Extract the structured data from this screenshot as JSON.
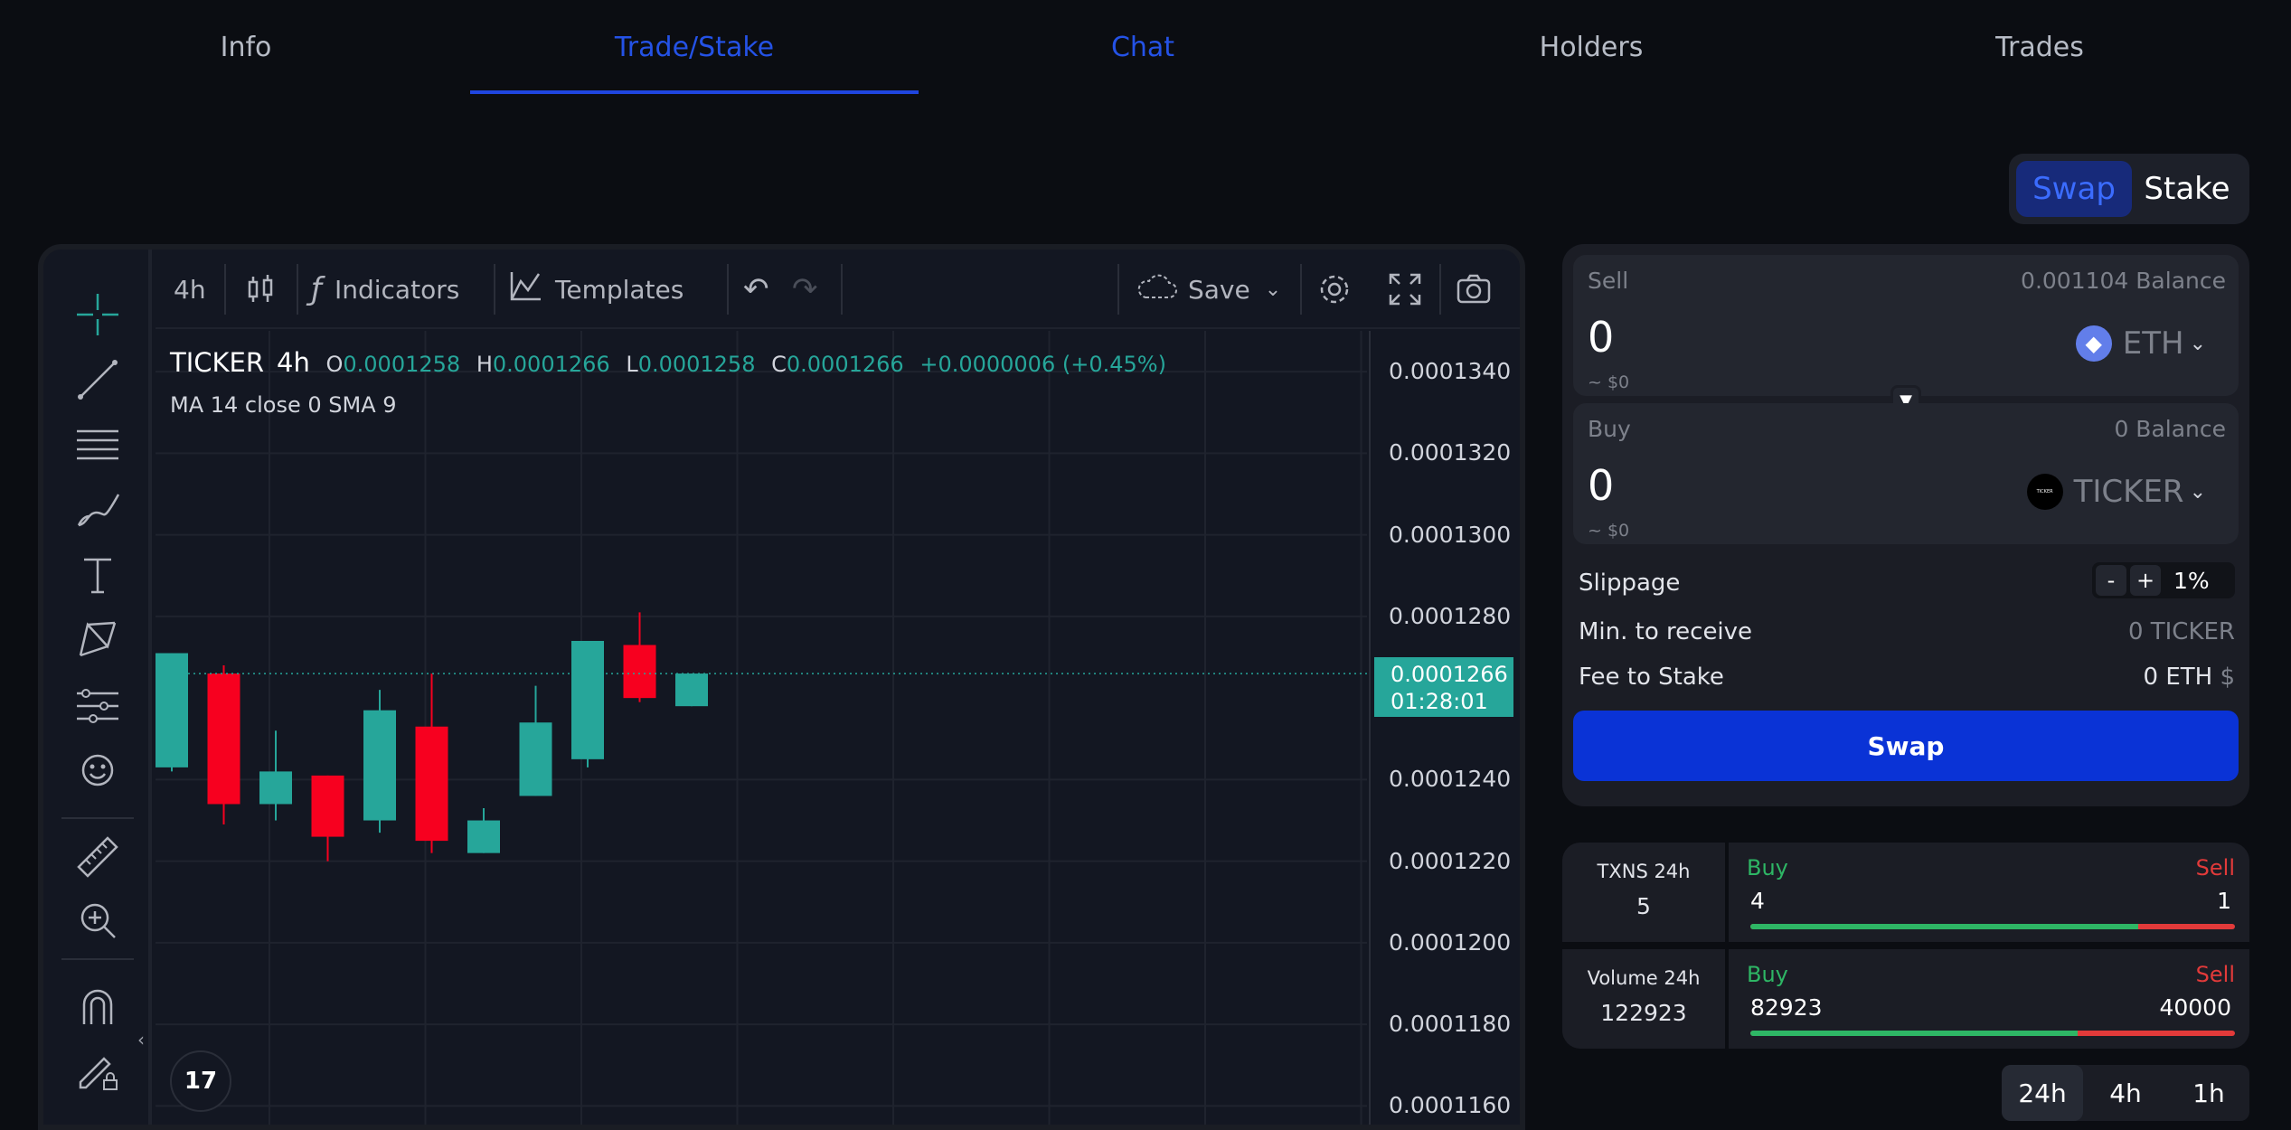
{
  "tabs": [
    "Info",
    "Trade/Stake",
    "Chat",
    "Holders",
    "Trades"
  ],
  "chart": {
    "toolbar": {
      "interval": "4h",
      "indicators": "Indicators",
      "templates": "Templates",
      "save": "Save"
    },
    "legend": {
      "symbol": "TICKER",
      "interval": "4h",
      "o_label": "O",
      "o": "0.0001258",
      "h_label": "H",
      "h": "0.0001266",
      "l_label": "L",
      "l": "0.0001258",
      "c_label": "C",
      "c": "0.0001266",
      "change": "+0.0000006 (+0.45%)",
      "ma": "MA 14 close 0 SMA 9"
    },
    "price_labels": [
      "0.0001340",
      "0.0001320",
      "0.0001300",
      "0.0001280",
      "0.0001240",
      "0.0001220",
      "0.0001200",
      "0.0001180",
      "0.0001160"
    ],
    "current_price": "0.0001266",
    "countdown": "01:28:01",
    "logo": "17"
  },
  "chart_data": {
    "type": "candlestick",
    "ylim": [
      0.0001155,
      0.000135
    ],
    "candles": [
      {
        "o": 0.0001243,
        "h": 0.0001262,
        "l": 0.0001242,
        "c": 0.0001271
      },
      {
        "o": 0.0001266,
        "h": 0.0001268,
        "l": 0.0001229,
        "c": 0.0001234
      },
      {
        "o": 0.0001234,
        "h": 0.0001252,
        "l": 0.000123,
        "c": 0.0001242
      },
      {
        "o": 0.0001241,
        "h": 0.0001241,
        "l": 0.000122,
        "c": 0.0001226
      },
      {
        "o": 0.000123,
        "h": 0.0001262,
        "l": 0.0001227,
        "c": 0.0001257
      },
      {
        "o": 0.0001253,
        "h": 0.0001266,
        "l": 0.0001222,
        "c": 0.0001225
      },
      {
        "o": 0.0001222,
        "h": 0.0001233,
        "l": 0.0001222,
        "c": 0.000123
      },
      {
        "o": 0.0001236,
        "h": 0.0001263,
        "l": 0.0001236,
        "c": 0.0001254
      },
      {
        "o": 0.0001245,
        "h": 0.0001273,
        "l": 0.0001243,
        "c": 0.0001274
      },
      {
        "o": 0.0001273,
        "h": 0.0001281,
        "l": 0.0001259,
        "c": 0.000126
      },
      {
        "o": 0.0001258,
        "h": 0.0001266,
        "l": 0.0001258,
        "c": 0.0001266
      }
    ]
  },
  "swap": {
    "toggle": [
      "Swap",
      "Stake"
    ],
    "sell": {
      "label": "Sell",
      "balance": "0.001104 Balance",
      "amount": "0",
      "usd": "~ $0",
      "token": "ETH"
    },
    "buy": {
      "label": "Buy",
      "balance": "0 Balance",
      "amount": "0",
      "usd": "~ $0",
      "token": "TICKER",
      "token_icon_text": "TICKER"
    },
    "slippage_label": "Slippage",
    "minus": "-",
    "plus": "+",
    "slippage": "1%",
    "min_receive_label": "Min. to receive",
    "min_receive": "0 TICKER",
    "fee_label": "Fee to Stake",
    "fee": "0 ETH",
    "fee_unit": "$",
    "button": "Swap",
    "colors": {
      "accent": "#0a33d6",
      "buy": "#2eb665",
      "sell": "#e23a3a"
    }
  },
  "stats": {
    "txns": {
      "title": "TXNS 24h",
      "total": "5",
      "buy_label": "Buy",
      "sell_label": "Sell",
      "buy": "4",
      "sell": "1",
      "buy_fraction": 0.8
    },
    "volume": {
      "title": "Volume 24h",
      "total": "122923",
      "buy_label": "Buy",
      "sell_label": "Sell",
      "buy": "82923",
      "sell": "40000",
      "buy_fraction": 0.675
    }
  },
  "timeframes": [
    "24h",
    "4h",
    "1h"
  ]
}
